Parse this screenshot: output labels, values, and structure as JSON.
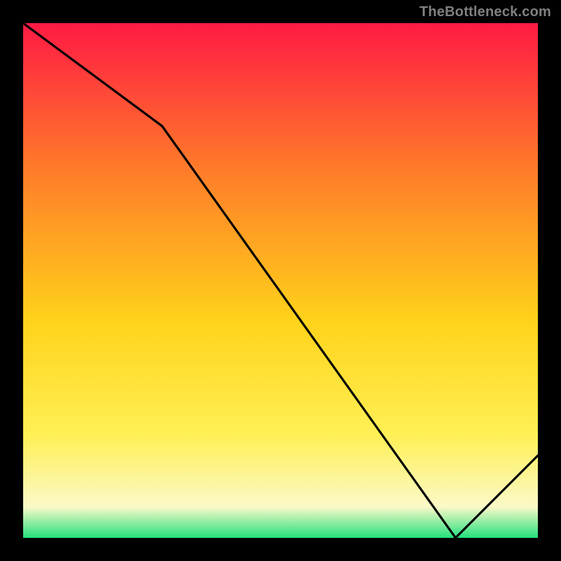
{
  "attribution": "TheBottleneck.com",
  "chart_data": {
    "type": "line",
    "title": "",
    "xlabel": "",
    "ylabel": "",
    "xlim": [
      0,
      100
    ],
    "ylim": [
      0,
      100
    ],
    "annotation_label": "",
    "background_gradient": {
      "top": "#ff1a44",
      "upper_mid": "#ff7a2a",
      "mid": "#ffd31a",
      "lower_mid": "#fff055",
      "lower": "#fbf9c8",
      "bottom": "#24e07d"
    },
    "curve": {
      "name": "bottleneck-curve",
      "x": [
        0,
        27,
        84,
        100
      ],
      "y": [
        100,
        80,
        0,
        16
      ]
    }
  },
  "colors": {
    "frame": "#000000",
    "curve": "#000000",
    "attribution": "#808080",
    "annotation": "#d8322a"
  }
}
